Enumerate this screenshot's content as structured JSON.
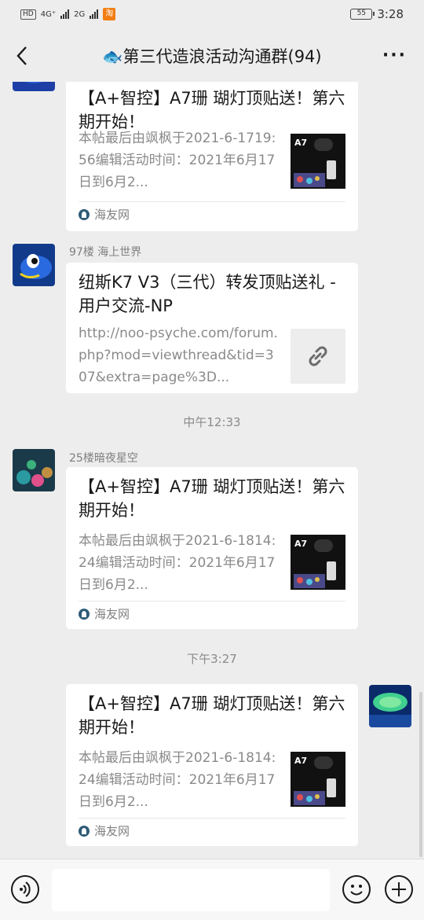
{
  "status_bar": {
    "hd_label": "HD",
    "net1": "4G⁺",
    "net2": "2G",
    "flag": "淘",
    "battery": "55",
    "time": "3:28"
  },
  "nav": {
    "title": "🐟第三代造浪活动沟通群(94)",
    "more_label": "···"
  },
  "messages": [
    {
      "card_title": "【A+智控】A7珊 瑚灯顶贴送！第六期开始！",
      "card_desc": "本帖最后由飒枫于2021-6-1719:56编辑活动时间：2021年6月17日到6月2...",
      "source": "海友网"
    },
    {
      "sender": "97楼 海上世界",
      "card_title": "纽斯K7 V3（三代）转发顶贴送礼 - 用户交流-NP",
      "card_desc": "http://noo-psyche.com/forum.php?mod=viewthread&tid=307&extra=page%3D..."
    },
    {
      "timestamp": "中午12:33"
    },
    {
      "sender": "25楼暗夜星空",
      "card_title": "【A+智控】A7珊 瑚灯顶贴送！第六期开始！",
      "card_desc": "本帖最后由飒枫于2021-6-1814:24编辑活动时间：2021年6月17日到6月2...",
      "source": "海友网"
    },
    {
      "timestamp": "下午3:27"
    },
    {
      "card_title": "【A+智控】A7珊 瑚灯顶贴送！第六期开始！",
      "card_desc": "本帖最后由飒枫于2021-6-1814:24编辑活动时间：2021年6月17日到6月2...",
      "source": "海友网"
    }
  ],
  "thumb_label": "A7",
  "colors": {
    "background": "#ededed",
    "card": "#ffffff",
    "text": "#191919",
    "muted": "#8a8a8a"
  }
}
